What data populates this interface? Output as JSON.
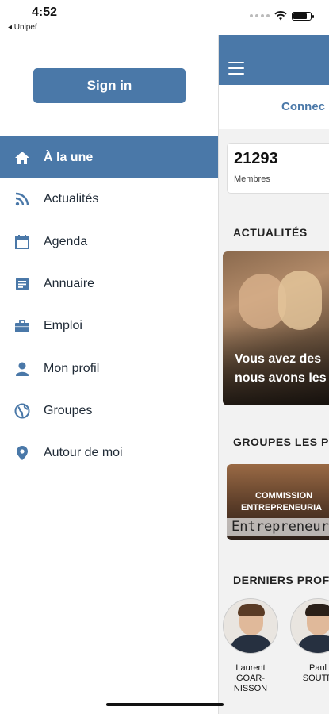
{
  "status": {
    "time": "4:52",
    "back_label": "◂ Unipef"
  },
  "drawer": {
    "signin_label": "Sign in",
    "items": [
      {
        "label": "À la une",
        "icon": "home-icon",
        "active": true
      },
      {
        "label": "Actualités",
        "icon": "rss-icon"
      },
      {
        "label": "Agenda",
        "icon": "calendar-icon"
      },
      {
        "label": "Annuaire",
        "icon": "directory-icon"
      },
      {
        "label": "Emploi",
        "icon": "briefcase-icon"
      },
      {
        "label": "Mon profil",
        "icon": "person-icon"
      },
      {
        "label": "Groupes",
        "icon": "globe-icon"
      },
      {
        "label": "Autour de moi",
        "icon": "location-pin-icon"
      }
    ]
  },
  "main": {
    "connect_label": "Connec",
    "stats": {
      "value": "21293",
      "label": "Membres"
    },
    "news_title": "ACTUALITÉS",
    "news_card": {
      "line1": "Vous avez des",
      "line2": "nous avons les"
    },
    "groups_title": "GROUPES LES P",
    "group_card": {
      "line1": "COMMISSION",
      "line2": "ENTREPRENEURIA",
      "line3": "Entrepreneuri"
    },
    "profiles_title": "DERNIERS PROF",
    "profiles": [
      {
        "line1": "Laurent",
        "line2": "GOAR-",
        "line3": "NISSON"
      },
      {
        "line1": "Paul",
        "line2": "SOUTR",
        "line3": ""
      }
    ]
  },
  "colors": {
    "accent": "#4a78a8",
    "menu_icon": "#4a78a8",
    "background": "#f2f2f2"
  }
}
